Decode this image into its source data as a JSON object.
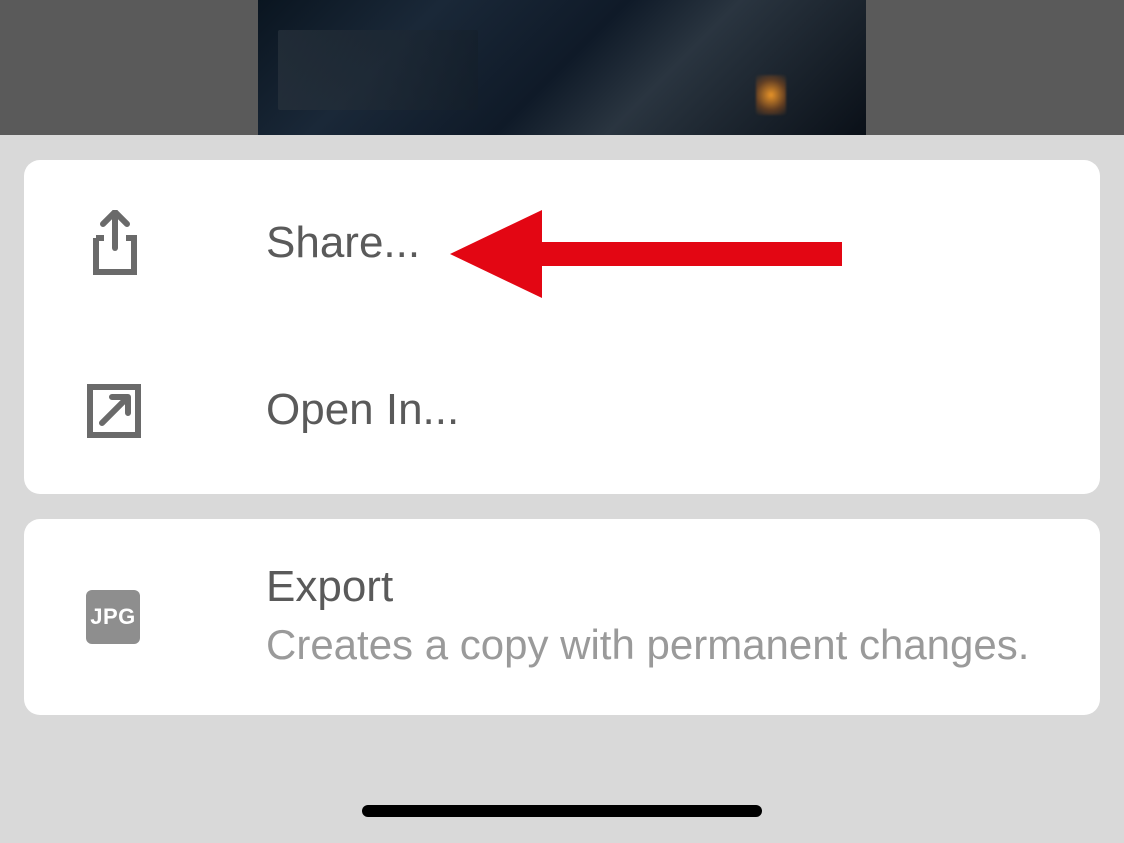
{
  "menu": {
    "share": {
      "label": "Share..."
    },
    "openIn": {
      "label": "Open In..."
    },
    "export": {
      "title": "Export",
      "subtitle": "Creates a copy with permanent changes.",
      "badge": "JPG"
    }
  },
  "annotation": {
    "arrowColor": "#e30613"
  }
}
